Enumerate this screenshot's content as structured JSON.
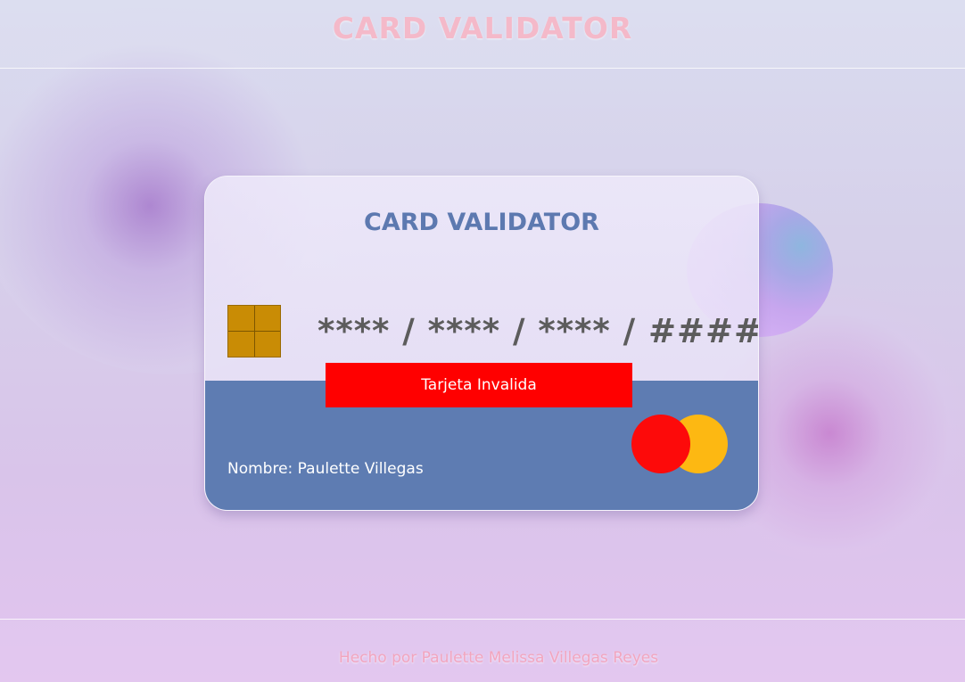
{
  "header": {
    "title": "CARD VALIDATOR"
  },
  "card": {
    "title": "CARD VALIDATOR",
    "masked_number": "**** / **** / **** / ####",
    "status_label": "Tarjeta Invalida",
    "holder_line": "Nombre: Paulette Villegas",
    "chip_icon": "card-chip-icon",
    "brand_icon": "mastercard-logo-icon"
  },
  "footer": {
    "credit": "Hecho por Paulette Melissa Villegas Reyes"
  },
  "colors": {
    "header_title": "#f4b9c9",
    "card_title": "#5d79b0",
    "card_band": "#5e7cb2",
    "status_error": "#ff0000",
    "chip": "#c98c05",
    "logo_red": "#fd0a0a",
    "logo_yellow": "#fdb812",
    "footer_text": "#f2a5be"
  }
}
